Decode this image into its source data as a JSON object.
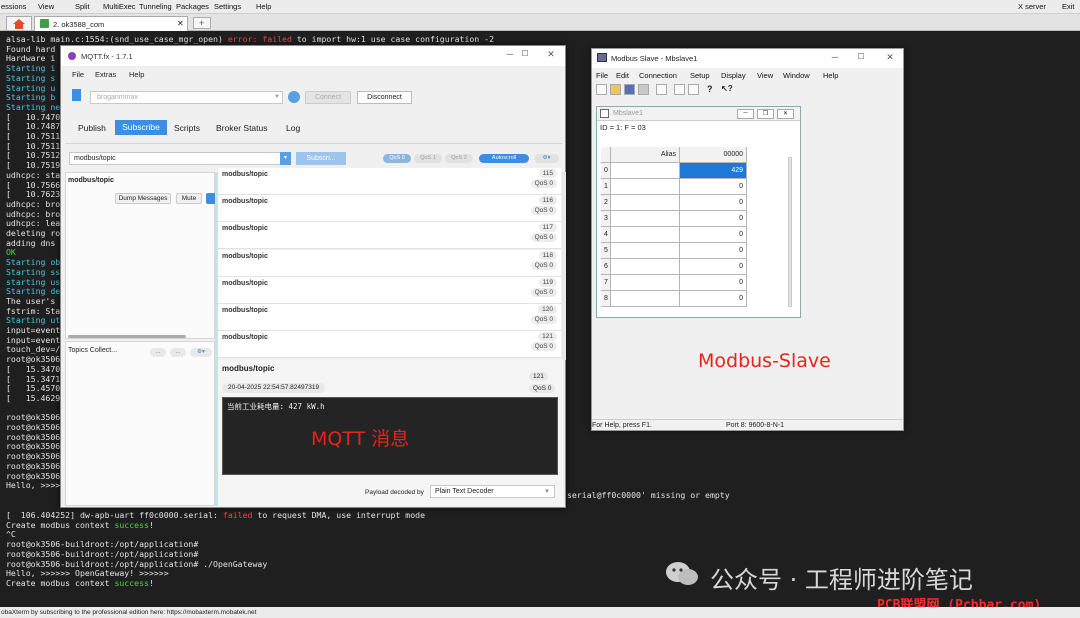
{
  "menubar": {
    "sessions": "essions",
    "view": "View",
    "split": "Split",
    "multiexec": "MultiExec",
    "tunneling": "Tunneling",
    "packages": "Packages",
    "settings": "Settings",
    "help": "Help",
    "xserver": "X server",
    "exit": "Exit"
  },
  "tab": {
    "label": "2. ok3588_com"
  },
  "terminal": {
    "top_lines": [
      {
        "parts": [
          {
            "t": "alsa-lib main.c:1554:(snd_use_case_mgr_open) ",
            "c": ""
          },
          {
            "t": "error: failed",
            "c": "red"
          },
          {
            "t": " to import hw:1 use case configuration -2",
            "c": ""
          }
        ]
      },
      {
        "parts": [
          {
            "t": "Found hard",
            "c": ""
          }
        ]
      },
      {
        "parts": [
          {
            "t": "Hardware i",
            "c": ""
          }
        ]
      },
      {
        "parts": [
          {
            "t": "Starting i",
            "c": "cyan"
          }
        ]
      },
      {
        "parts": [
          {
            "t": "Starting s",
            "c": "cyan"
          }
        ]
      },
      {
        "parts": [
          {
            "t": "Starting u",
            "c": "cyan"
          }
        ]
      },
      {
        "parts": [
          {
            "t": "Starting b",
            "c": "cyan"
          }
        ]
      },
      {
        "parts": [
          {
            "t": "Starting ne",
            "c": "cyan"
          }
        ]
      },
      {
        "parts": [
          {
            "t": "[   10.7470",
            "c": ""
          }
        ]
      },
      {
        "parts": [
          {
            "t": "[   10.7487",
            "c": ""
          }
        ]
      },
      {
        "parts": [
          {
            "t": "[   10.7511",
            "c": ""
          }
        ]
      },
      {
        "parts": [
          {
            "t": "[   10.7511",
            "c": ""
          }
        ]
      },
      {
        "parts": [
          {
            "t": "[   10.7512",
            "c": ""
          }
        ]
      },
      {
        "parts": [
          {
            "t": "[   10.7519",
            "c": ""
          }
        ]
      },
      {
        "parts": [
          {
            "t": "udhcpc: sta",
            "c": ""
          }
        ]
      },
      {
        "parts": [
          {
            "t": "[   10.7566",
            "c": ""
          }
        ]
      },
      {
        "parts": [
          {
            "t": "[   10.7623",
            "c": ""
          }
        ]
      },
      {
        "parts": [
          {
            "t": "udhcpc: bro",
            "c": ""
          }
        ]
      },
      {
        "parts": [
          {
            "t": "udhcpc: bro",
            "c": ""
          }
        ]
      },
      {
        "parts": [
          {
            "t": "udhcpc: lea",
            "c": ""
          }
        ]
      },
      {
        "parts": [
          {
            "t": "deleting ro",
            "c": ""
          }
        ]
      },
      {
        "parts": [
          {
            "t": "adding dns ",
            "c": ""
          }
        ]
      },
      {
        "parts": [
          {
            "t": "OK",
            "c": "green"
          }
        ]
      },
      {
        "parts": [
          {
            "t": "Starting ob",
            "c": "cyan"
          }
        ]
      },
      {
        "parts": [
          {
            "t": "Starting ss",
            "c": "cyan"
          }
        ]
      },
      {
        "parts": [
          {
            "t": "starting us",
            "c": "cyan"
          }
        ]
      },
      {
        "parts": [
          {
            "t": "Starting de",
            "c": "cyan"
          }
        ]
      },
      {
        "parts": [
          {
            "t": "The user's ",
            "c": ""
          }
        ]
      },
      {
        "parts": [
          {
            "t": "fstrim: Sta",
            "c": ""
          }
        ]
      },
      {
        "parts": [
          {
            "t": "Starting ut",
            "c": "cyan"
          }
        ]
      },
      {
        "parts": [
          {
            "t": "input=event",
            "c": ""
          }
        ]
      },
      {
        "parts": [
          {
            "t": "input=event",
            "c": ""
          }
        ]
      },
      {
        "parts": [
          {
            "t": "touch_dev=/",
            "c": ""
          }
        ]
      },
      {
        "parts": [
          {
            "t": "root@ok3506",
            "c": ""
          }
        ]
      },
      {
        "parts": [
          {
            "t": "[   15.3470",
            "c": ""
          }
        ]
      },
      {
        "parts": [
          {
            "t": "[   15.3471",
            "c": ""
          }
        ]
      },
      {
        "parts": [
          {
            "t": "[   15.4570",
            "c": ""
          }
        ]
      },
      {
        "parts": [
          {
            "t": "[   15.4629",
            "c": ""
          }
        ]
      },
      {
        "parts": [
          {
            "t": "",
            "c": ""
          }
        ]
      },
      {
        "parts": [
          {
            "t": "root@ok3506",
            "c": ""
          }
        ]
      },
      {
        "parts": [
          {
            "t": "root@ok3506",
            "c": ""
          }
        ]
      },
      {
        "parts": [
          {
            "t": "root@ok3506",
            "c": ""
          }
        ]
      },
      {
        "parts": [
          {
            "t": "root@ok3506",
            "c": ""
          }
        ]
      },
      {
        "parts": [
          {
            "t": "root@ok3506",
            "c": ""
          }
        ]
      },
      {
        "parts": [
          {
            "t": "root@ok3506",
            "c": ""
          }
        ]
      },
      {
        "parts": [
          {
            "t": "root@ok3506",
            "c": ""
          }
        ]
      },
      {
        "parts": [
          {
            "t": "Hello, >>>>",
            "c": ""
          }
        ]
      }
    ],
    "side_line": "serial@ff0c0000' missing or empty",
    "bottom_lines": [
      {
        "parts": [
          {
            "t": "[  106.404252] dw-apb-uart ff0c0000.serial: ",
            "c": ""
          },
          {
            "t": "failed",
            "c": "red"
          },
          {
            "t": " to request DMA, use interrupt mode",
            "c": ""
          }
        ]
      },
      {
        "parts": [
          {
            "t": "Create modbus context ",
            "c": ""
          },
          {
            "t": "success",
            "c": "green"
          },
          {
            "t": "!",
            "c": ""
          }
        ]
      },
      {
        "parts": [
          {
            "t": "^C",
            "c": ""
          }
        ]
      },
      {
        "parts": [
          {
            "t": "root@ok3506-buildroot:/opt/application#",
            "c": ""
          }
        ]
      },
      {
        "parts": [
          {
            "t": "root@ok3506-buildroot:/opt/application#",
            "c": ""
          }
        ]
      },
      {
        "parts": [
          {
            "t": "root@ok3506-buildroot:/opt/application# ./OpenGateway",
            "c": ""
          }
        ]
      },
      {
        "parts": [
          {
            "t": "Hello, >>>>>> OpenGateway! >>>>>>",
            "c": ""
          }
        ]
      },
      {
        "parts": [
          {
            "t": "Create modbus context ",
            "c": ""
          },
          {
            "t": "success",
            "c": "green"
          },
          {
            "t": "!",
            "c": ""
          }
        ]
      }
    ]
  },
  "statusbar": {
    "text": "obaXterm by subscribing to the professional edition here:  https://mobaxterm.mobatek.net"
  },
  "watermark": {
    "text": "公众号 · 工程师进阶笔记",
    "site": "PCB联盟网 (Pcbbar.com)"
  },
  "mqtt": {
    "title": "MQTT.fx - 1.7.1",
    "menu": {
      "file": "File",
      "extras": "Extras",
      "help": "Help"
    },
    "profile": "broganmmax",
    "connect_label": "Connect",
    "disconnect_label": "Disconnect",
    "tabs": {
      "publish": "Publish",
      "subscribe": "Subscribe",
      "scripts": "Scripts",
      "broker_status": "Broker Status",
      "log": "Log"
    },
    "subscribe_topic": "modbus/topic",
    "subscribe_btn": "Subscri...",
    "qos": [
      "QoS 0",
      "QoS 1",
      "QoS 2"
    ],
    "autoscroll": "Autoscroll",
    "sub_item_topic": "modbus/topic",
    "dump_label": "Dump Messages",
    "mute_label": "Mute",
    "topics_collect": "Topics Collect...",
    "messages": [
      {
        "topic": "modbus/topic",
        "num": "115",
        "qos": "QoS 0"
      },
      {
        "topic": "modbus/topic",
        "num": "116",
        "qos": "QoS 0"
      },
      {
        "topic": "modbus/topic",
        "num": "117",
        "qos": "QoS 0"
      },
      {
        "topic": "modbus/topic",
        "num": "118",
        "qos": "QoS 0"
      },
      {
        "topic": "modbus/topic",
        "num": "119",
        "qos": "QoS 0"
      },
      {
        "topic": "modbus/topic",
        "num": "120",
        "qos": "QoS 0"
      },
      {
        "topic": "modbus/topic",
        "num": "121",
        "qos": "QoS 0"
      }
    ],
    "detail": {
      "topic": "modbus/topic",
      "num": "121",
      "timestamp": "20-04-2025  22:54:57.82497319",
      "qos": "QoS 0",
      "payload": "当前工业耗电量: 427 kW.h"
    },
    "decoder_label": "Payload decoded by",
    "decoder_value": "Plain Text Decoder",
    "overlay_label": "MQTT 消息"
  },
  "modbus": {
    "title": "Modbus Slave - Mbslave1",
    "menu": {
      "file": "File",
      "edit": "Edit",
      "connection": "Connection",
      "setup": "Setup",
      "display": "Display",
      "view": "View",
      "window": "Window",
      "help": "Help"
    },
    "child_title": "Mbslave1",
    "id_line": "ID = 1: F = 03",
    "col_alias": "Alias",
    "col_addr": "00000",
    "rows": [
      {
        "idx": "0",
        "value": "429"
      },
      {
        "idx": "1",
        "value": "0"
      },
      {
        "idx": "2",
        "value": "0"
      },
      {
        "idx": "3",
        "value": "0"
      },
      {
        "idx": "4",
        "value": "0"
      },
      {
        "idx": "5",
        "value": "0"
      },
      {
        "idx": "6",
        "value": "0"
      },
      {
        "idx": "7",
        "value": "0"
      },
      {
        "idx": "8",
        "value": "0"
      }
    ],
    "overlay_label": "Modbus-Slave",
    "status_help": "For Help, press F1.",
    "status_port": "Port 8: 9600-8-N-1"
  },
  "colors": {
    "overlay_red": "#e8231b",
    "accent_blue": "#3b8ee3",
    "selected_cell": "#1e78d7"
  }
}
